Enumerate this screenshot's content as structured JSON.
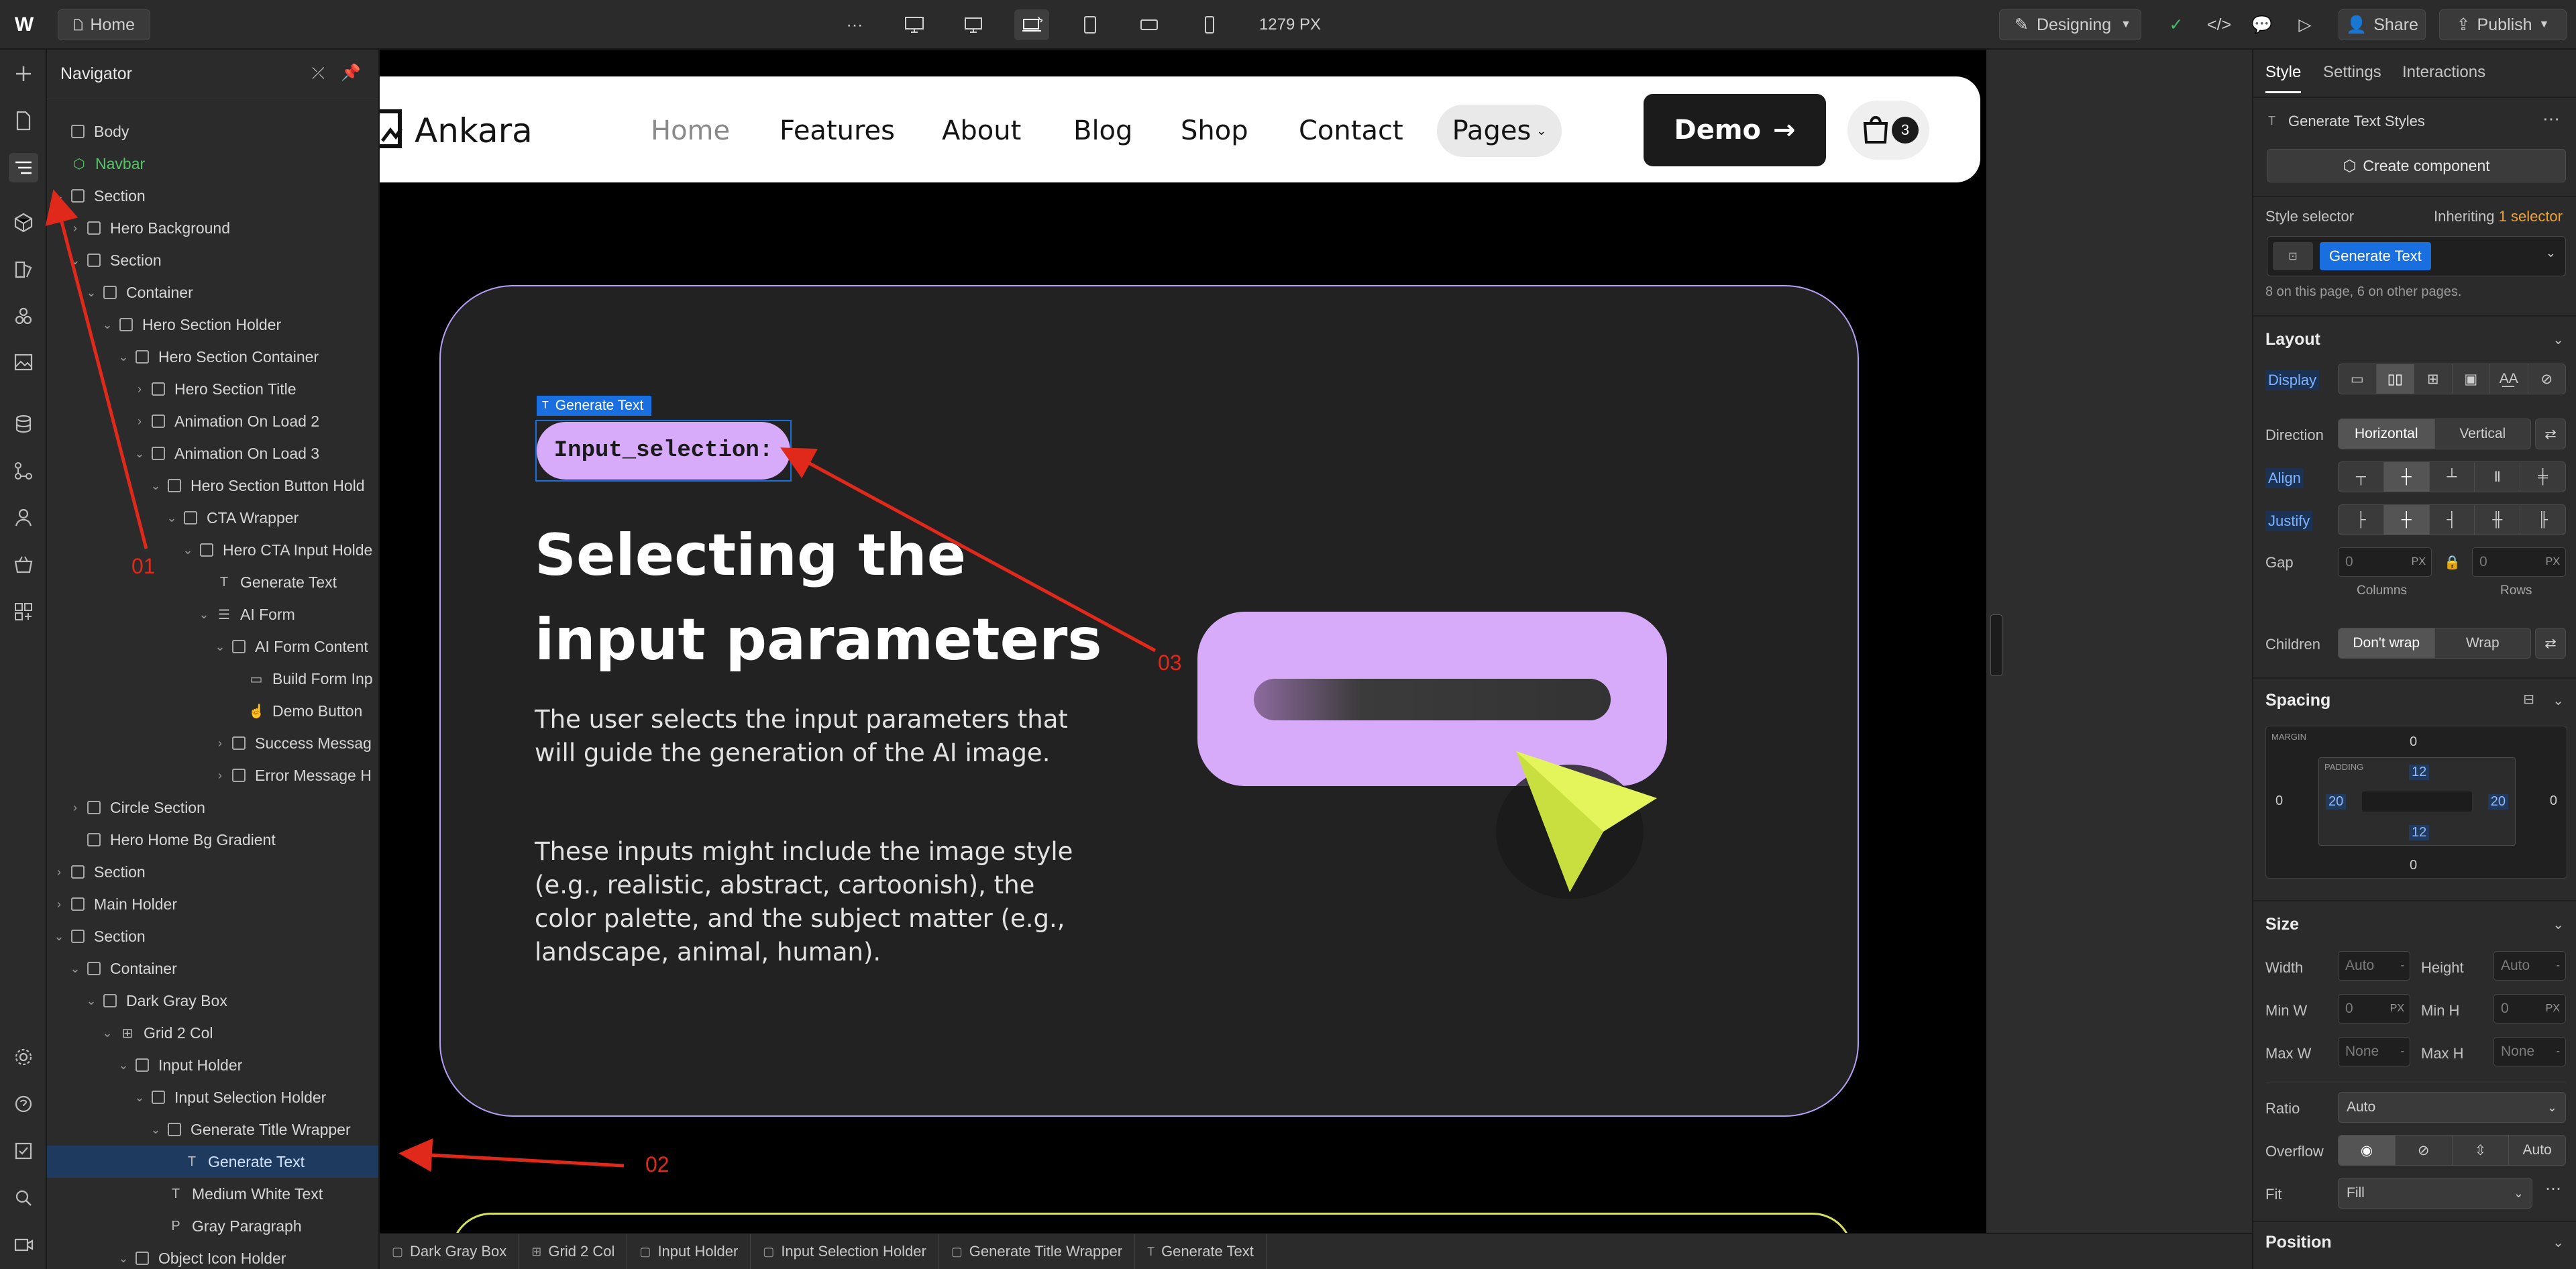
{
  "topbar": {
    "page_name": "Home",
    "more": "···",
    "width_readout": "1279 PX",
    "mode": "Designing",
    "share": "Share",
    "publish": "Publish"
  },
  "navigator": {
    "title": "Navigator",
    "items": [
      {
        "label": "Body",
        "depth": 0,
        "kind": "box",
        "twisty": ""
      },
      {
        "label": "Navbar",
        "depth": 0,
        "kind": "component",
        "twisty": ""
      },
      {
        "label": "Section",
        "depth": 0,
        "kind": "box",
        "twisty": "v"
      },
      {
        "label": "Hero Background",
        "depth": 1,
        "kind": "box",
        "twisty": ">"
      },
      {
        "label": "Section",
        "depth": 1,
        "kind": "box",
        "twisty": "v"
      },
      {
        "label": "Container",
        "depth": 2,
        "kind": "box",
        "twisty": "v"
      },
      {
        "label": "Hero Section Holder",
        "depth": 3,
        "kind": "box",
        "twisty": "v"
      },
      {
        "label": "Hero Section Container",
        "depth": 4,
        "kind": "box",
        "twisty": "v"
      },
      {
        "label": "Hero Section Title",
        "depth": 5,
        "kind": "box",
        "twisty": ">"
      },
      {
        "label": "Animation On Load 2",
        "depth": 5,
        "kind": "box",
        "twisty": ">"
      },
      {
        "label": "Animation On Load 3",
        "depth": 5,
        "kind": "box",
        "twisty": "v"
      },
      {
        "label": "Hero Section Button Hold",
        "depth": 6,
        "kind": "box",
        "twisty": "v"
      },
      {
        "label": "CTA Wrapper",
        "depth": 7,
        "kind": "box",
        "twisty": "v"
      },
      {
        "label": "Hero CTA Input Holde",
        "depth": 8,
        "kind": "box",
        "twisty": "v"
      },
      {
        "label": "Generate Text",
        "depth": 9,
        "kind": "text",
        "twisty": ""
      },
      {
        "label": "AI Form",
        "depth": 9,
        "kind": "form",
        "twisty": "v"
      },
      {
        "label": "AI Form Content",
        "depth": 10,
        "kind": "box",
        "twisty": "v"
      },
      {
        "label": "Build Form Inp",
        "depth": 11,
        "kind": "input",
        "twisty": ""
      },
      {
        "label": "Demo Button",
        "depth": 11,
        "kind": "pointer",
        "twisty": ""
      },
      {
        "label": "Success Messag",
        "depth": 10,
        "kind": "box",
        "twisty": ">"
      },
      {
        "label": "Error Message H",
        "depth": 10,
        "kind": "box",
        "twisty": ">"
      },
      {
        "label": "Circle Section",
        "depth": 1,
        "kind": "box",
        "twisty": ">"
      },
      {
        "label": "Hero Home Bg Gradient",
        "depth": 1,
        "kind": "box",
        "twisty": ""
      },
      {
        "label": "Section",
        "depth": 0,
        "kind": "box",
        "twisty": ">"
      },
      {
        "label": "Main Holder",
        "depth": 0,
        "kind": "box",
        "twisty": ">"
      },
      {
        "label": "Section",
        "depth": 0,
        "kind": "box",
        "twisty": "v"
      },
      {
        "label": "Container",
        "depth": 1,
        "kind": "box",
        "twisty": "v"
      },
      {
        "label": "Dark Gray Box",
        "depth": 2,
        "kind": "box",
        "twisty": "v"
      },
      {
        "label": "Grid 2 Col",
        "depth": 3,
        "kind": "grid",
        "twisty": "v"
      },
      {
        "label": "Input Holder",
        "depth": 4,
        "kind": "box",
        "twisty": "v"
      },
      {
        "label": "Input Selection Holder",
        "depth": 5,
        "kind": "box",
        "twisty": "v"
      },
      {
        "label": "Generate Title Wrapper",
        "depth": 6,
        "kind": "box",
        "twisty": "v"
      },
      {
        "label": "Generate Text",
        "depth": 7,
        "kind": "text",
        "twisty": "",
        "selected": true
      },
      {
        "label": "Medium White Text",
        "depth": 6,
        "kind": "text",
        "twisty": ""
      },
      {
        "label": "Gray Paragraph",
        "depth": 6,
        "kind": "para",
        "twisty": ""
      },
      {
        "label": "Object Icon Holder",
        "depth": 4,
        "kind": "box",
        "twisty": "v"
      }
    ]
  },
  "site": {
    "brand": "Ankara",
    "nav_links": [
      "Home",
      "Features",
      "About",
      "Blog",
      "Shop",
      "Contact"
    ],
    "pages": "Pages",
    "demo": "Demo",
    "cart_count": "3",
    "selected_badge": "Generate Text",
    "pill_text": "Input_selection:",
    "heading_line1": "Selecting the",
    "heading_line2": "input parameters",
    "para1_line1": "The user selects the input parameters that",
    "para1_line2": "will guide the generation of the AI image.",
    "para2_line1": "These inputs might include the image style",
    "para2_line2": "(e.g., realistic, abstract, cartoonish), the",
    "para2_line3": "color palette, and the subject matter (e.g.,",
    "para2_line4": "landscape, animal, human)."
  },
  "annotations": {
    "a1": "01",
    "a2": "02",
    "a3": "03",
    "color": "#e0291b"
  },
  "breadcrumb": [
    "Dark Gray Box",
    "Grid 2 Col",
    "Input Holder",
    "Input Selection Holder",
    "Generate Title Wrapper",
    "Generate Text"
  ],
  "right_panel": {
    "tabs": [
      "Style",
      "Settings",
      "Interactions"
    ],
    "element_name": "Generate Text Styles",
    "create_component": "Create component",
    "style_selector": "Style selector",
    "inheriting": "Inheriting",
    "inheriting_count": "1 selector",
    "class_chip": "Generate Text",
    "usage": "8 on this page, 6 on other pages.",
    "layout": "Layout",
    "display": "Display",
    "direction": "Direction",
    "horizontal": "Horizontal",
    "vertical": "Vertical",
    "align": "Align",
    "justify": "Justify",
    "gap": "Gap",
    "gap_col": "0",
    "gap_row": "0",
    "px": "PX",
    "columns": "Columns",
    "rows": "Rows",
    "children": "Children",
    "dont_wrap": "Don't wrap",
    "wrap": "Wrap",
    "spacing": "Spacing",
    "margin_label": "MARGIN",
    "padding_label": "PADDING",
    "margin": {
      "top": "0",
      "right": "0",
      "bottom": "0",
      "left": "0"
    },
    "padding": {
      "top": "12",
      "right": "20",
      "bottom": "12",
      "left": "20"
    },
    "size": "Size",
    "width": "Width",
    "height": "Height",
    "min_w": "Min W",
    "min_h": "Min H",
    "max_w": "Max W",
    "max_h": "Max H",
    "auto": "Auto",
    "zero": "0",
    "none": "None",
    "ratio": "Ratio",
    "ratio_val": "Auto",
    "overflow": "Overflow",
    "overflow_auto": "Auto",
    "fit": "Fit",
    "fit_val": "Fill",
    "position": "Position",
    "accent": "#1a6fe0"
  }
}
